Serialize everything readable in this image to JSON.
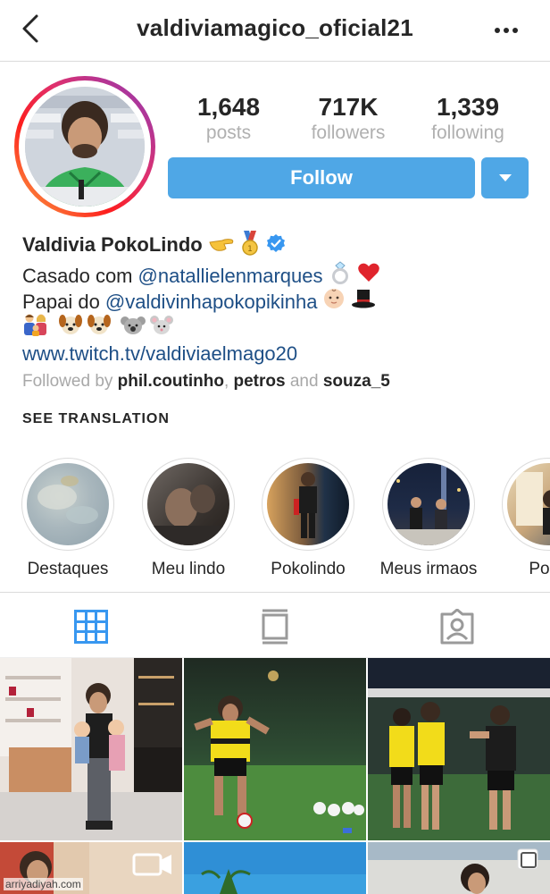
{
  "header": {
    "username": "valdiviamagico_oficial21",
    "back_icon": "chevron-left-icon",
    "more_icon": "more-horizontal-icon"
  },
  "profile": {
    "stats": [
      {
        "value": "1,648",
        "label": "posts"
      },
      {
        "value": "717K",
        "label": "followers"
      },
      {
        "value": "1,339",
        "label": "following"
      }
    ],
    "follow_label": "Follow",
    "follow_color": "#4fa7e6"
  },
  "bio": {
    "name": "Valdivia PokoLindo",
    "line1_prefix": "Casado com",
    "line1_mention": "@natallielenmarques",
    "line2_prefix": "Papai do",
    "line2_mention": "@valdivinhapokopikinha",
    "link": "www.twitch.tv/valdiviaelmago20",
    "followed_by_prefix": "Followed by",
    "followed_by_users": [
      "phil.coutinho",
      "petros",
      "souza_5"
    ],
    "followed_by_sep1": ",",
    "followed_by_and": "and",
    "see_translation": "SEE TRANSLATION",
    "mention_color": "#1e4f86"
  },
  "highlights": [
    {
      "label": "Destaques"
    },
    {
      "label": "Meu lindo"
    },
    {
      "label": "Pokolindo"
    },
    {
      "label": "Meus irmaos"
    },
    {
      "label": "Poko"
    }
  ],
  "tabs": [
    {
      "name": "grid",
      "active": true
    },
    {
      "name": "feed",
      "active": false
    },
    {
      "name": "tagged",
      "active": false
    }
  ],
  "watermark": "arriyadiyah.com"
}
